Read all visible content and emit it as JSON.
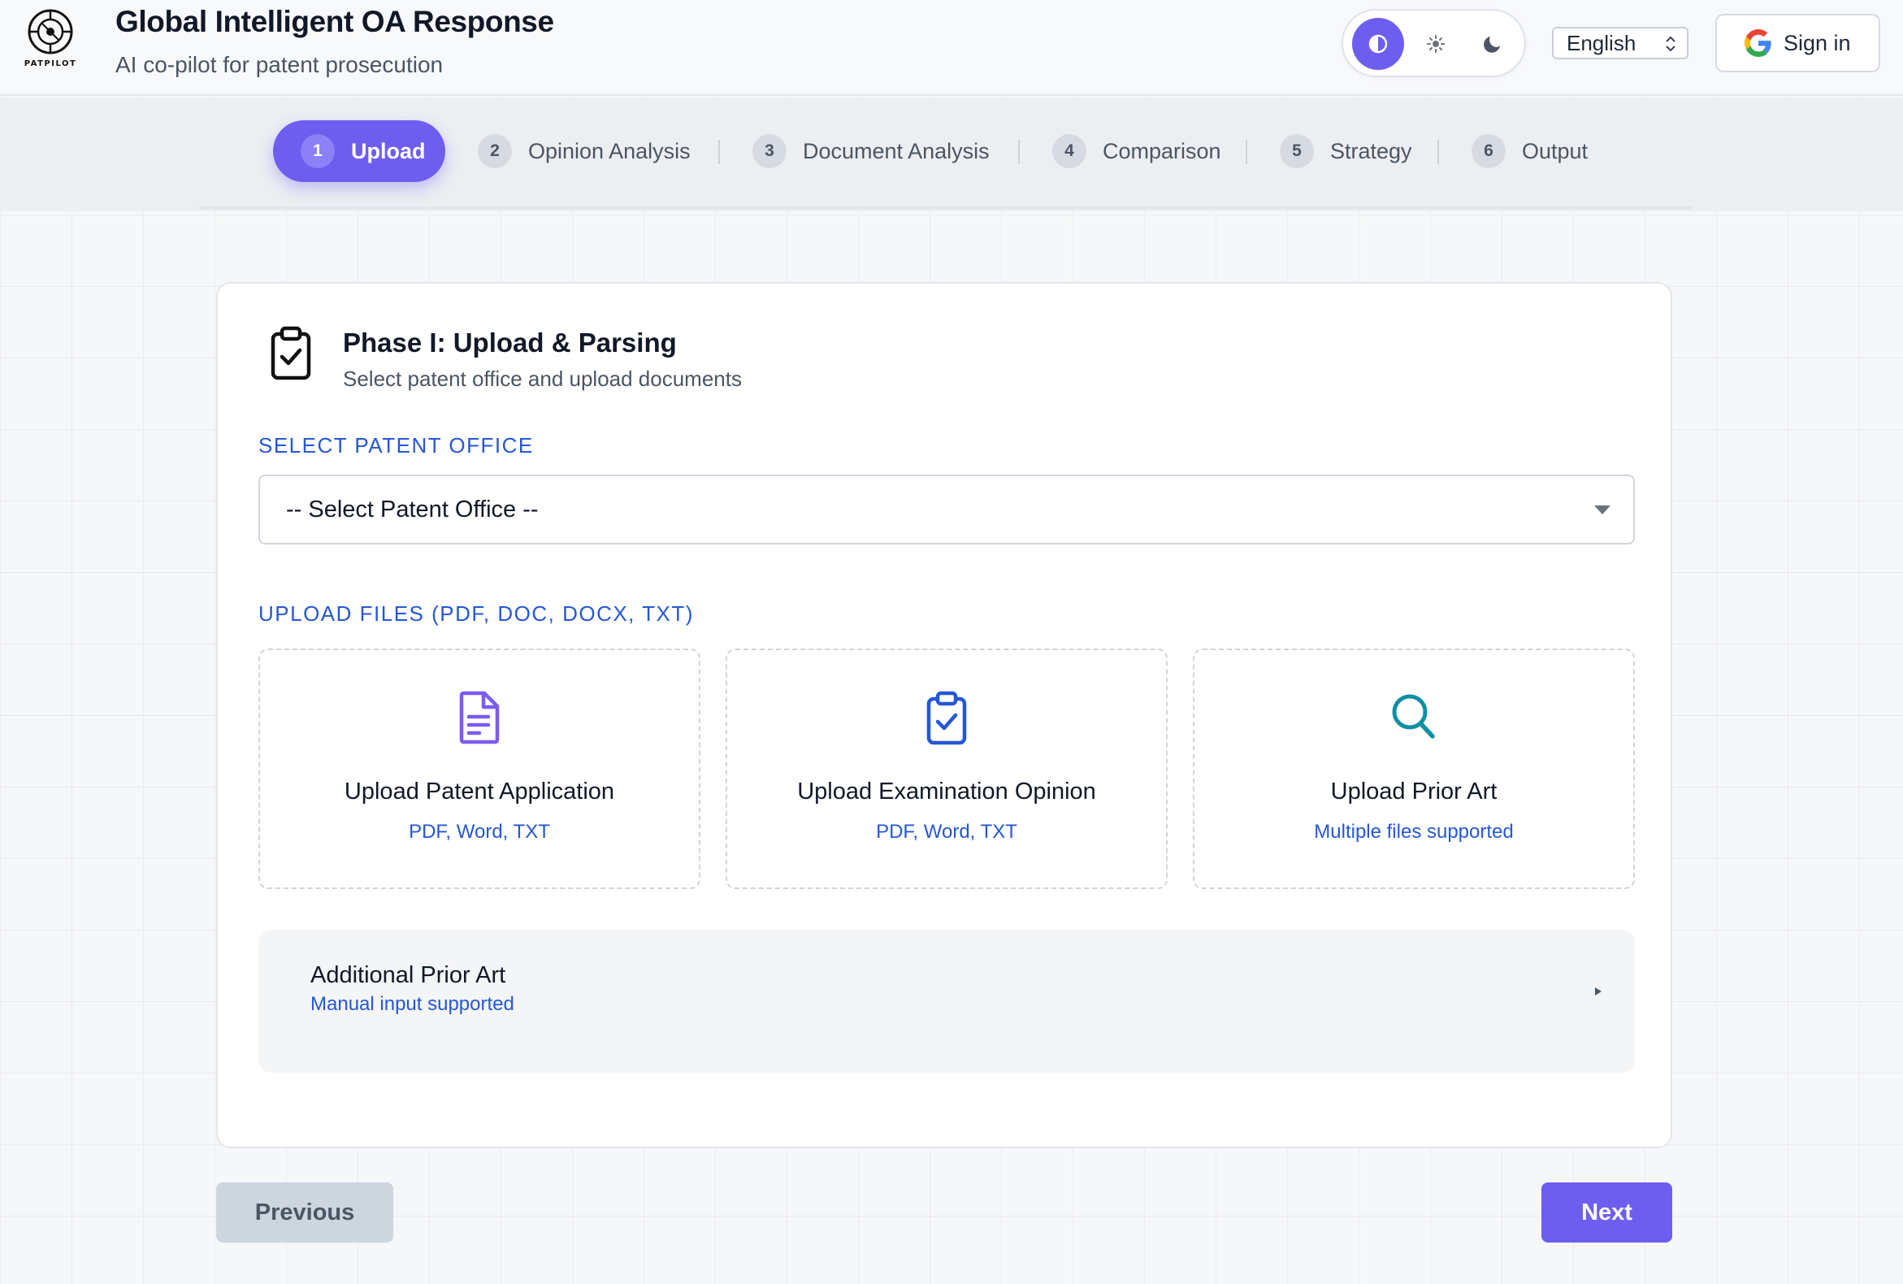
{
  "header": {
    "logo_text": "PATPILOT",
    "title": "Global Intelligent OA Response",
    "subtitle": "AI co-pilot for patent prosecution",
    "theme_options": [
      "auto",
      "light",
      "dark"
    ],
    "theme_selected": "auto",
    "language": "English",
    "signin_label": "Sign in"
  },
  "stepper": {
    "active": 1,
    "steps": [
      {
        "num": "1",
        "label": "Upload"
      },
      {
        "num": "2",
        "label": "Opinion Analysis"
      },
      {
        "num": "3",
        "label": "Document Analysis"
      },
      {
        "num": "4",
        "label": "Comparison"
      },
      {
        "num": "5",
        "label": "Strategy"
      },
      {
        "num": "6",
        "label": "Output"
      }
    ]
  },
  "card": {
    "icon": "clipboard-check-icon",
    "title": "Phase I: Upload & Parsing",
    "subtitle": "Select patent office and upload documents",
    "office_label": "SELECT PATENT OFFICE",
    "office_value": "-- Select Patent Office --",
    "upload_label": "UPLOAD FILES (PDF, DOC, DOCX, TXT)",
    "uploads": [
      {
        "icon": "document-icon",
        "title": "Upload Patent Application",
        "hint": "PDF, Word, TXT"
      },
      {
        "icon": "clipboard-check-icon",
        "title": "Upload Examination Opinion",
        "hint": "PDF, Word, TXT"
      },
      {
        "icon": "search-icon",
        "title": "Upload Prior Art",
        "hint": "Multiple files supported"
      }
    ],
    "additional": {
      "title": "Additional Prior Art",
      "hint": "Manual input supported"
    }
  },
  "footer": {
    "previous_label": "Previous",
    "next_label": "Next"
  },
  "colors": {
    "accent": "#6d5ef0",
    "link_blue": "#2557d6",
    "teal": "#0e8fa3"
  }
}
